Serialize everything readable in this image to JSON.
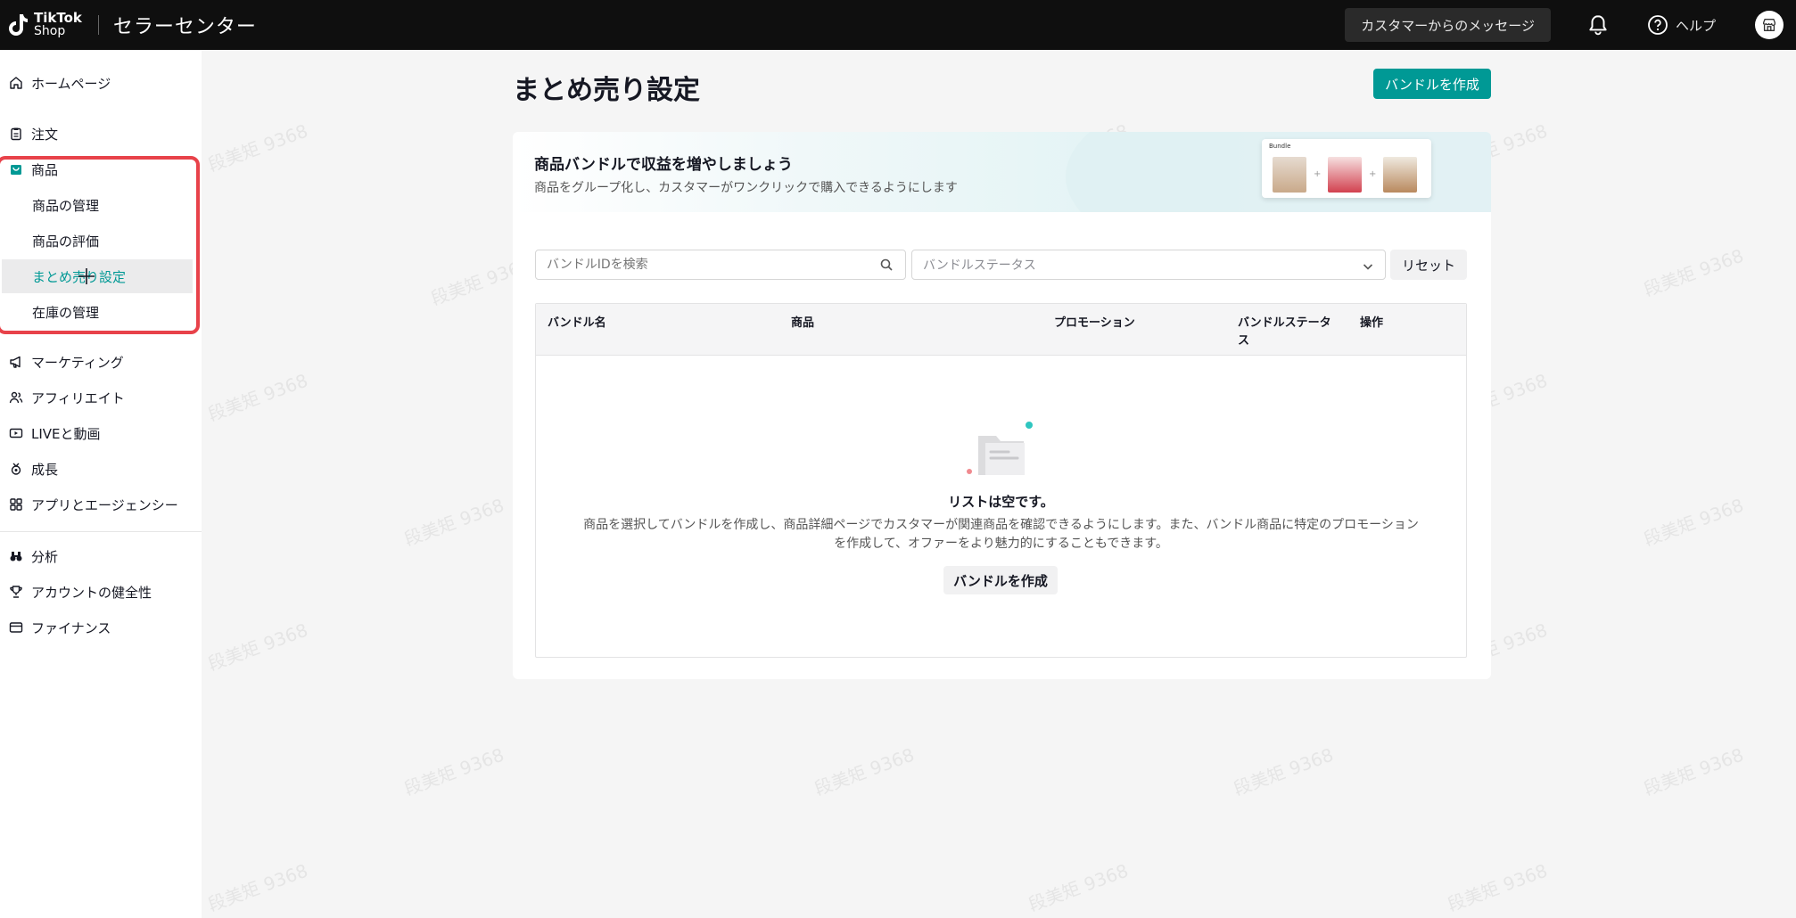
{
  "topbar": {
    "logo_line1": "TikTok",
    "logo_line2": "Shop",
    "title": "セラーセンター",
    "message_button": "カスタマーからのメッセージ",
    "help_label": "ヘルプ"
  },
  "sidebar": {
    "items": [
      {
        "label": "ホームページ",
        "icon": "home-icon"
      },
      {
        "label": "注文",
        "icon": "clipboard-icon"
      },
      {
        "label": "商品",
        "icon": "bag-icon"
      },
      {
        "label": "マーケティング",
        "icon": "megaphone-icon"
      },
      {
        "label": "アフィリエイト",
        "icon": "people-icon"
      },
      {
        "label": "LIVEと動画",
        "icon": "video-icon"
      },
      {
        "label": "成長",
        "icon": "growth-icon"
      },
      {
        "label": "アプリとエージェンシー",
        "icon": "apps-icon"
      },
      {
        "label": "分析",
        "icon": "binoculars-icon"
      },
      {
        "label": "アカウントの健全性",
        "icon": "trophy-icon"
      },
      {
        "label": "ファイナンス",
        "icon": "wallet-icon"
      }
    ],
    "product_sub": [
      {
        "label": "商品の管理"
      },
      {
        "label": "商品の評価"
      },
      {
        "label": "まとめ売り設定",
        "active": true
      },
      {
        "label": "在庫の管理"
      }
    ]
  },
  "main": {
    "page_title": "まとめ売り設定",
    "create_button": "バンドルを作成",
    "banner": {
      "title": "商品バンドルで収益を増やしましょう",
      "subtitle": "商品をグループ化し、カスタマーがワンクリックで購入できるようにします",
      "card_tag": "Bundle"
    },
    "filters": {
      "search_placeholder": "バンドルIDを検索",
      "status_placeholder": "バンドルステータス",
      "reset_button": "リセット"
    },
    "table": {
      "headers": [
        "バンドル名",
        "商品",
        "プロモーション",
        "バンドルステータス",
        "操作"
      ],
      "empty_title": "リストは空です。",
      "empty_desc": "商品を選択してバンドルを作成し、商品詳細ページでカスタマーが関連商品を確認できるようにします。また、バンドル商品に特定のプロモーションを作成して、オファーをより魅力的にすることもできます。",
      "empty_button": "バンドルを作成"
    }
  },
  "watermark": "段美矩 9368",
  "colors": {
    "accent": "#009995",
    "highlight": "#e8424a",
    "topbar": "#0f0f0f"
  }
}
